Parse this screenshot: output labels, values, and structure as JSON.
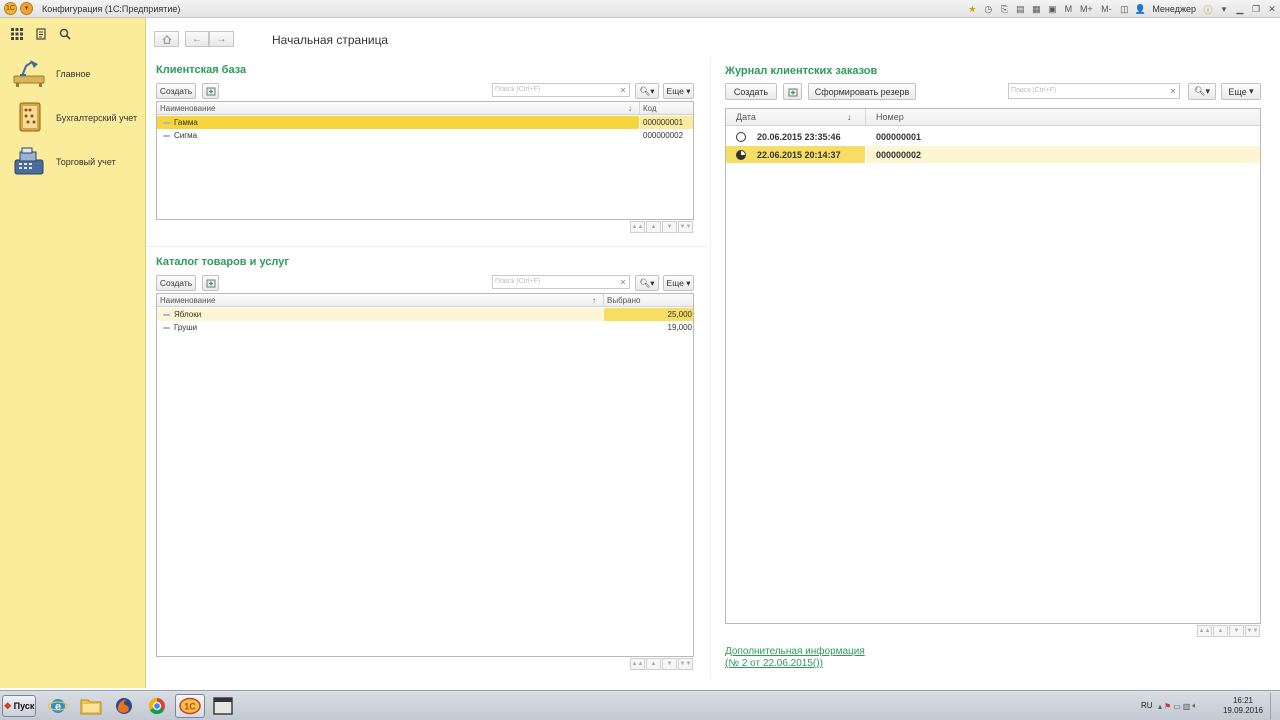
{
  "window": {
    "title": "Конфигурация (1С:Предприятие)",
    "user": "Менеджер",
    "menu_m": "M",
    "menu_mplus": "M+",
    "menu_mminus": "M-"
  },
  "sidebar": {
    "items": [
      {
        "label": "Главное"
      },
      {
        "label": "Бухгалтерский учет"
      },
      {
        "label": "Торговый учет"
      }
    ]
  },
  "page": {
    "title": "Начальная страница"
  },
  "clients": {
    "title": "Клиентская база",
    "create_label": "Создать",
    "search_placeholder": "Поиск (Ctrl+F)",
    "more_label": "Еще",
    "columns": {
      "name": "Наименование",
      "code": "Код"
    },
    "rows": [
      {
        "name": "Гамма",
        "code": "000000001"
      },
      {
        "name": "Сигма",
        "code": "000000002"
      }
    ]
  },
  "catalog": {
    "title": "Каталог товаров и услуг",
    "create_label": "Создать",
    "search_placeholder": "Поиск (Ctrl+F)",
    "more_label": "Еще",
    "columns": {
      "name": "Наименование",
      "selected": "Выбрано"
    },
    "rows": [
      {
        "name": "Яблоки",
        "selected": "25,000"
      },
      {
        "name": "Груши",
        "selected": "19,000"
      }
    ]
  },
  "orders": {
    "title": "Журнал клиентских заказов",
    "create_label": "Создать",
    "reserve_label": "Сформировать резерв",
    "search_placeholder": "Поиск (Ctrl+F)",
    "more_label": "Еще",
    "columns": {
      "date": "Дата",
      "number": "Номер"
    },
    "rows": [
      {
        "date": "20.06.2015 23:35:46",
        "number": "000000001"
      },
      {
        "date": "22.06.2015 20:14:37",
        "number": "000000002"
      }
    ],
    "extra_info_line1": "Дополнительная информация",
    "extra_info_line2": "(№ 2 от 22.06.2015())"
  },
  "taskbar": {
    "start_label": "Пуск",
    "lang": "RU",
    "time": "16:21",
    "date": "19.09.2016"
  },
  "colors": {
    "accent_green": "#2e9b5a",
    "sidebar_yellow": "#fbec9c",
    "selection_yellow": "#f6d53f"
  }
}
